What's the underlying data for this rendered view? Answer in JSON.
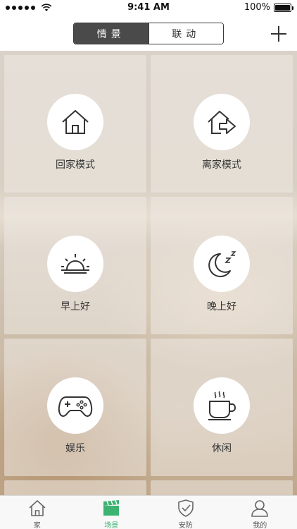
{
  "status_bar": {
    "time": "9:41 AM",
    "battery": "100%"
  },
  "nav": {
    "segments": [
      {
        "label": "情景",
        "active": true
      },
      {
        "label": "联动",
        "active": false
      }
    ],
    "add_icon": "plus-icon"
  },
  "scenes": [
    {
      "label": "回家模式",
      "icon": "home-icon"
    },
    {
      "label": "离家模式",
      "icon": "leave-home-icon"
    },
    {
      "label": "早上好",
      "icon": "sunrise-icon"
    },
    {
      "label": "晚上好",
      "icon": "moon-sleep-icon"
    },
    {
      "label": "娱乐",
      "icon": "gamepad-icon"
    },
    {
      "label": "休闲",
      "icon": "coffee-cup-icon"
    }
  ],
  "tabs": [
    {
      "label": "家",
      "icon": "home-icon",
      "active": false
    },
    {
      "label": "场景",
      "icon": "clapperboard-icon",
      "active": true
    },
    {
      "label": "安防",
      "icon": "shield-icon",
      "active": false
    },
    {
      "label": "我的",
      "icon": "user-icon",
      "active": false
    }
  ],
  "colors": {
    "accent": "#3cb371",
    "segment_active": "#4a4a4a"
  }
}
